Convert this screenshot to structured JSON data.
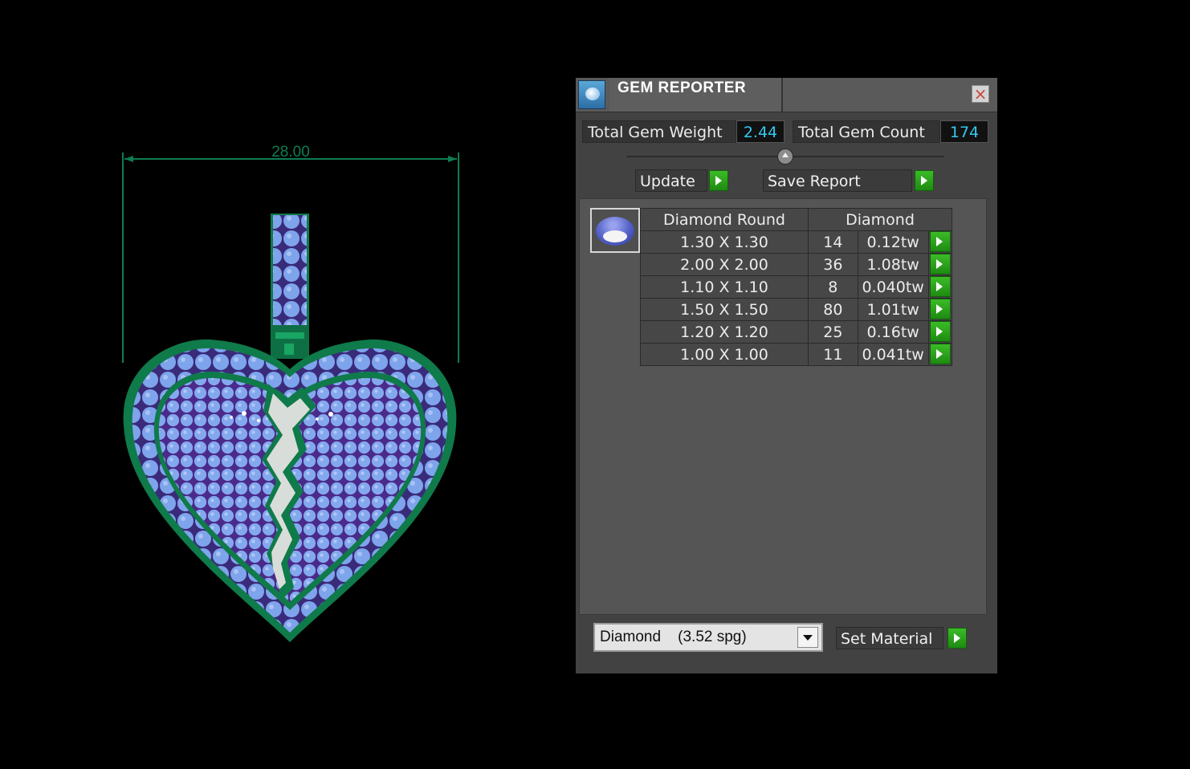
{
  "viewport": {
    "dimension_label": "28.00"
  },
  "panel": {
    "title": "GEM REPORTER",
    "close_icon": "close-icon",
    "total_weight_label": "Total Gem Weight",
    "total_weight_value": "2.44",
    "total_count_label": "Total Gem Count",
    "total_count_value": "174",
    "update_label": "Update",
    "save_report_label": "Save Report",
    "table": {
      "header_shape": "Diamond Round",
      "header_material": "Diamond",
      "rows": [
        {
          "size": "1.30 X 1.30",
          "count": "14",
          "weight": "0.12tw"
        },
        {
          "size": "2.00 X 2.00",
          "count": "36",
          "weight": "1.08tw"
        },
        {
          "size": "1.10 X 1.10",
          "count": "8",
          "weight": "0.040tw"
        },
        {
          "size": "1.50 X 1.50",
          "count": "80",
          "weight": "1.01tw"
        },
        {
          "size": "1.20 X 1.20",
          "count": "25",
          "weight": "0.16tw"
        },
        {
          "size": "1.00 X 1.00",
          "count": "11",
          "weight": "0.041tw"
        }
      ]
    },
    "material_selected": "Diamond    (3.52 spg)",
    "set_material_label": "Set Material"
  },
  "colors": {
    "metal": "#0f7a4a",
    "gem": "#7ea4ec",
    "value_text": "#35c8ee",
    "go_button": "#2aa51a"
  }
}
